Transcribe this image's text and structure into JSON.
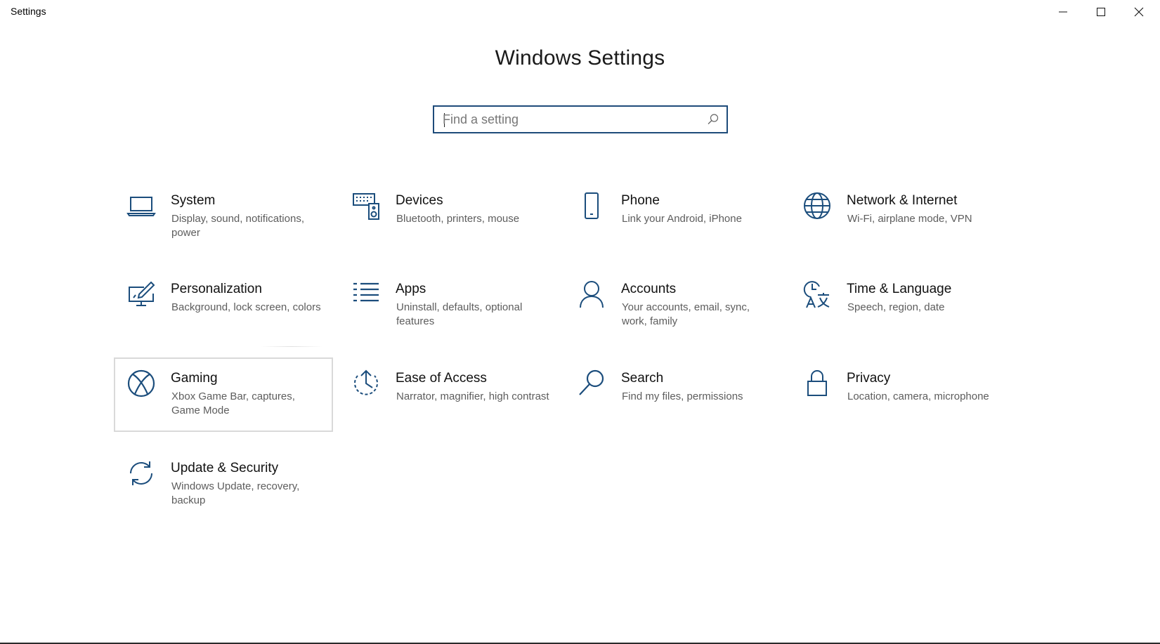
{
  "window": {
    "title": "Settings",
    "controls": [
      "minimize-icon",
      "maximize-icon",
      "close-icon"
    ]
  },
  "header": {
    "title": "Windows Settings"
  },
  "search": {
    "placeholder": "Find a setting",
    "value": "",
    "icon": "search-icon"
  },
  "colors": {
    "accent": "#1e4b7a",
    "icon": "#1b4d7c",
    "focus_border": "#d9d9d9",
    "description": "#5d5d5d"
  },
  "tiles": [
    {
      "title": "System",
      "description": "Display, sound, notifications, power",
      "icon": "laptop-icon"
    },
    {
      "title": "Devices",
      "description": "Bluetooth, printers, mouse",
      "icon": "keyboard-speaker-icon"
    },
    {
      "title": "Phone",
      "description": "Link your Android, iPhone",
      "icon": "phone-icon"
    },
    {
      "title": "Network & Internet",
      "description": "Wi-Fi, airplane mode, VPN",
      "icon": "globe-icon"
    },
    {
      "title": "Personalization",
      "description": "Background, lock screen, colors",
      "icon": "paint-screen-icon"
    },
    {
      "title": "Apps",
      "description": "Uninstall, defaults, optional features",
      "icon": "list-icon"
    },
    {
      "title": "Accounts",
      "description": "Your accounts, email, sync, work, family",
      "icon": "person-icon"
    },
    {
      "title": "Time & Language",
      "description": "Speech, region, date",
      "icon": "clock-language-icon"
    },
    {
      "title": "Gaming",
      "description": "Xbox Game Bar, captures, Game Mode",
      "icon": "xbox-icon",
      "focused": true
    },
    {
      "title": "Ease of Access",
      "description": "Narrator, magnifier, high contrast",
      "icon": "ease-of-access-icon"
    },
    {
      "title": "Search",
      "description": "Find my files, permissions",
      "icon": "magnifier-icon"
    },
    {
      "title": "Privacy",
      "description": "Location, camera, microphone",
      "icon": "lock-icon"
    },
    {
      "title": "Update & Security",
      "description": "Windows Update, recovery, backup",
      "icon": "sync-arrows-icon"
    }
  ]
}
